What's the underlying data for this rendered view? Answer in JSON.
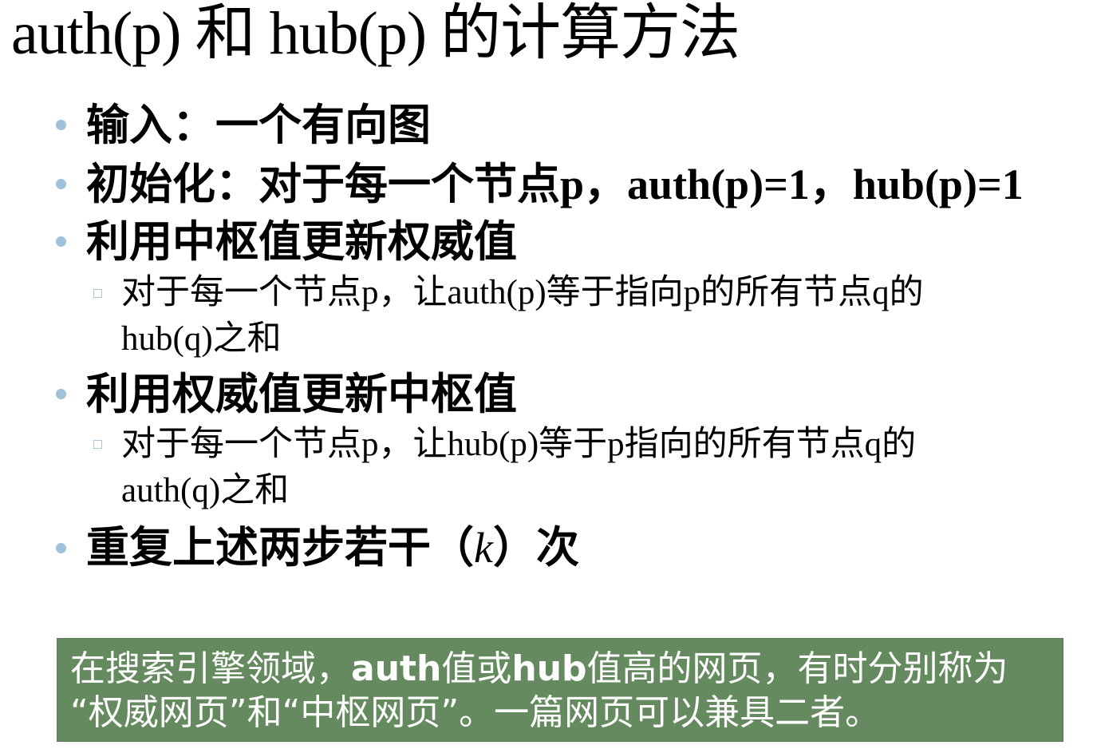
{
  "slide": {
    "title": "auth(p) 和 hub(p) 的计算方法",
    "bullets": [
      {
        "text": "输入：一个有向图"
      },
      {
        "text": "初始化：对于每一个节点p，auth(p)=1，hub(p)=1"
      },
      {
        "text": "利用中枢值更新权威值"
      },
      {
        "sub": "对于每一个节点p，让auth(p)等于指向p的所有节点q的hub(q)之和"
      },
      {
        "text": "利用权威值更新中枢值"
      },
      {
        "sub": "对于每一个节点p，让hub(p)等于p指向的所有节点q的auth(q)之和"
      },
      {
        "text_before": "重复上述两步若干（",
        "text_k": "k",
        "text_after": "）次"
      }
    ],
    "note": {
      "line1_part1": "在搜索引擎领域，",
      "line1_bold1": "auth",
      "line1_part2": "值或",
      "line1_bold2": "hub",
      "line1_part3": "值高的网页，有时分别称为",
      "line2": "“权威网页”和“中枢网页”。一篇网页可以兼具二者。"
    },
    "colors": {
      "bullet": "#9fc1d9",
      "note_background": "#668a5f",
      "note_text": "#ffffff"
    }
  }
}
